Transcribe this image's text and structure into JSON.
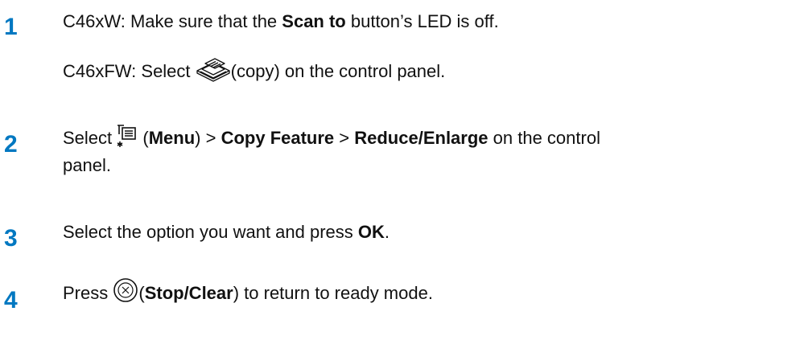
{
  "steps": [
    {
      "number": "1",
      "lines": [
        {
          "pre": "C46xW: Make sure that the ",
          "bold": "Scan to",
          "post": " button’s LED is off."
        },
        {
          "pre": "C46xFW: Select ",
          "icon": "copy-icon",
          "post": "(copy) on the control panel."
        }
      ]
    },
    {
      "number": "2",
      "text": {
        "select": "Select ",
        "icon": "menu-icon",
        "open": " (",
        "menu": "Menu",
        "close": ") > ",
        "copy_feature": "Copy Feature",
        "sep": " > ",
        "reduce_enlarge": "Reduce/Enlarge",
        "tail": " on the control",
        "continuation": "panel."
      }
    },
    {
      "number": "3",
      "text": {
        "pre": "Select the option you want and press ",
        "bold": "OK",
        "post": "."
      }
    },
    {
      "number": "4",
      "text": {
        "pre": "Press ",
        "icon": "stop-clear-icon",
        "open": "(",
        "bold": "Stop/Clear",
        "post": ") to return to ready mode."
      }
    }
  ],
  "colors": {
    "step_number": "#0078c1",
    "text": "#111111"
  }
}
